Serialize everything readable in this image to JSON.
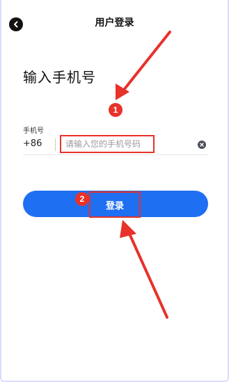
{
  "header": {
    "title": "用户登录",
    "back_icon": "chevron-left-icon"
  },
  "main": {
    "heading": "输入手机号",
    "phone_label": "手机号",
    "country_code": "+86",
    "phone_input": {
      "value": "",
      "placeholder": "请输入您的手机号码"
    },
    "clear_icon": "clear-icon",
    "login_label": "登录"
  },
  "annotations": {
    "badge_1": "1",
    "badge_2": "2",
    "highlight_color": "#e8322a"
  },
  "colors": {
    "accent": "#1f6ff2",
    "annotation": "#e8322a"
  }
}
